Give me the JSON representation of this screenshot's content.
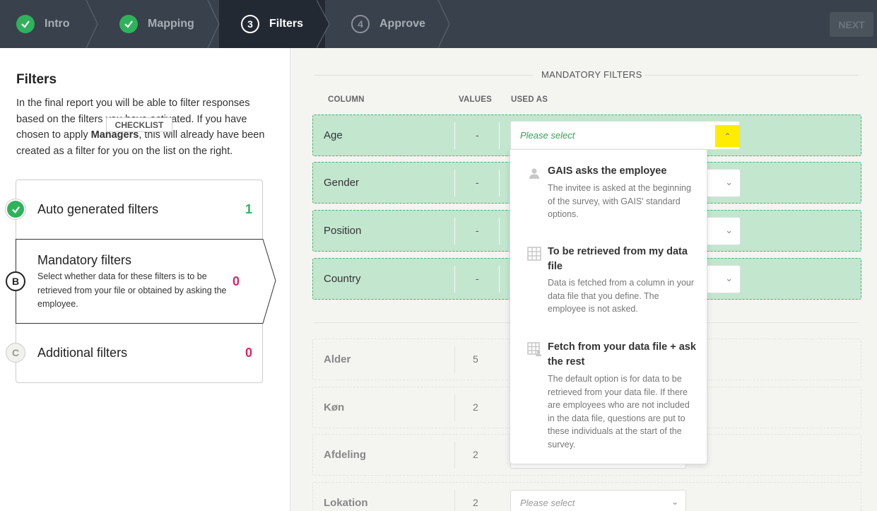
{
  "stepper": {
    "steps": [
      {
        "number": "",
        "label": "Intro",
        "state": "done"
      },
      {
        "number": "",
        "label": "Mapping",
        "state": "done"
      },
      {
        "number": "3",
        "label": "Filters",
        "state": "active"
      },
      {
        "number": "4",
        "label": "Approve",
        "state": "todo"
      }
    ],
    "next_label": "NEXT"
  },
  "left": {
    "title": "Filters",
    "description_part1": "In the final report you will be able to filter responses based on the filters you have activated. If you have chosen to apply ",
    "description_bold": "Managers",
    "description_part2": ", this will already have been created as a filter for you on the list on the right.",
    "checklist_label": "CHECKLIST",
    "items": [
      {
        "badge": "",
        "title": "Auto generated filters",
        "count": "1",
        "count_color": "#2fb25b",
        "state": "done"
      },
      {
        "badge": "B",
        "title": "Mandatory filters",
        "subtitle": "Select whether data for these filters is to be retrieved from your file or obtained by asking the employee.",
        "count": "0",
        "count_color": "#e0245e",
        "state": "active"
      },
      {
        "badge": "C",
        "title": "Additional filters",
        "count": "0",
        "count_color": "#e0245e",
        "state": "todo"
      }
    ]
  },
  "right": {
    "section_title": "MANDATORY FILTERS",
    "columns": {
      "column": "COLUMN",
      "values": "VALUES",
      "used_as": "USED AS"
    },
    "mandatory_rows": [
      {
        "name": "Age",
        "values": "-"
      },
      {
        "name": "Gender",
        "values": "-"
      },
      {
        "name": "Position",
        "values": "-"
      },
      {
        "name": "Country",
        "values": "-"
      }
    ],
    "file_rows": [
      {
        "name": "Alder",
        "values": "5"
      },
      {
        "name": "Køn",
        "values": "2"
      },
      {
        "name": "Afdeling",
        "values": "2"
      },
      {
        "name": "Lokation",
        "values": "2",
        "placeholder": "Please select"
      }
    ],
    "dropdown": {
      "placeholder": "Please select",
      "options": [
        {
          "icon": "person-icon",
          "title": "GAIS asks the employee",
          "description": "The invitee is asked at the beginning of the survey, with GAIS' standard options."
        },
        {
          "icon": "grid-icon",
          "title": "To be retrieved from my data file",
          "description": "Data is fetched from a column in your data file that you define. The employee is not asked."
        },
        {
          "icon": "grid-person-icon",
          "title": "Fetch from your data file + ask the rest",
          "description": "The default option is for data to be retrieved from your data file. If there are employees who are not included in the data file, questions are put to these individuals at the start of the survey."
        }
      ]
    }
  },
  "colors": {
    "topbar": "#39414c",
    "success": "#2fb25b",
    "danger": "#e0245e",
    "row_green": "#c3e6cf",
    "highlight": "#ffec00"
  }
}
